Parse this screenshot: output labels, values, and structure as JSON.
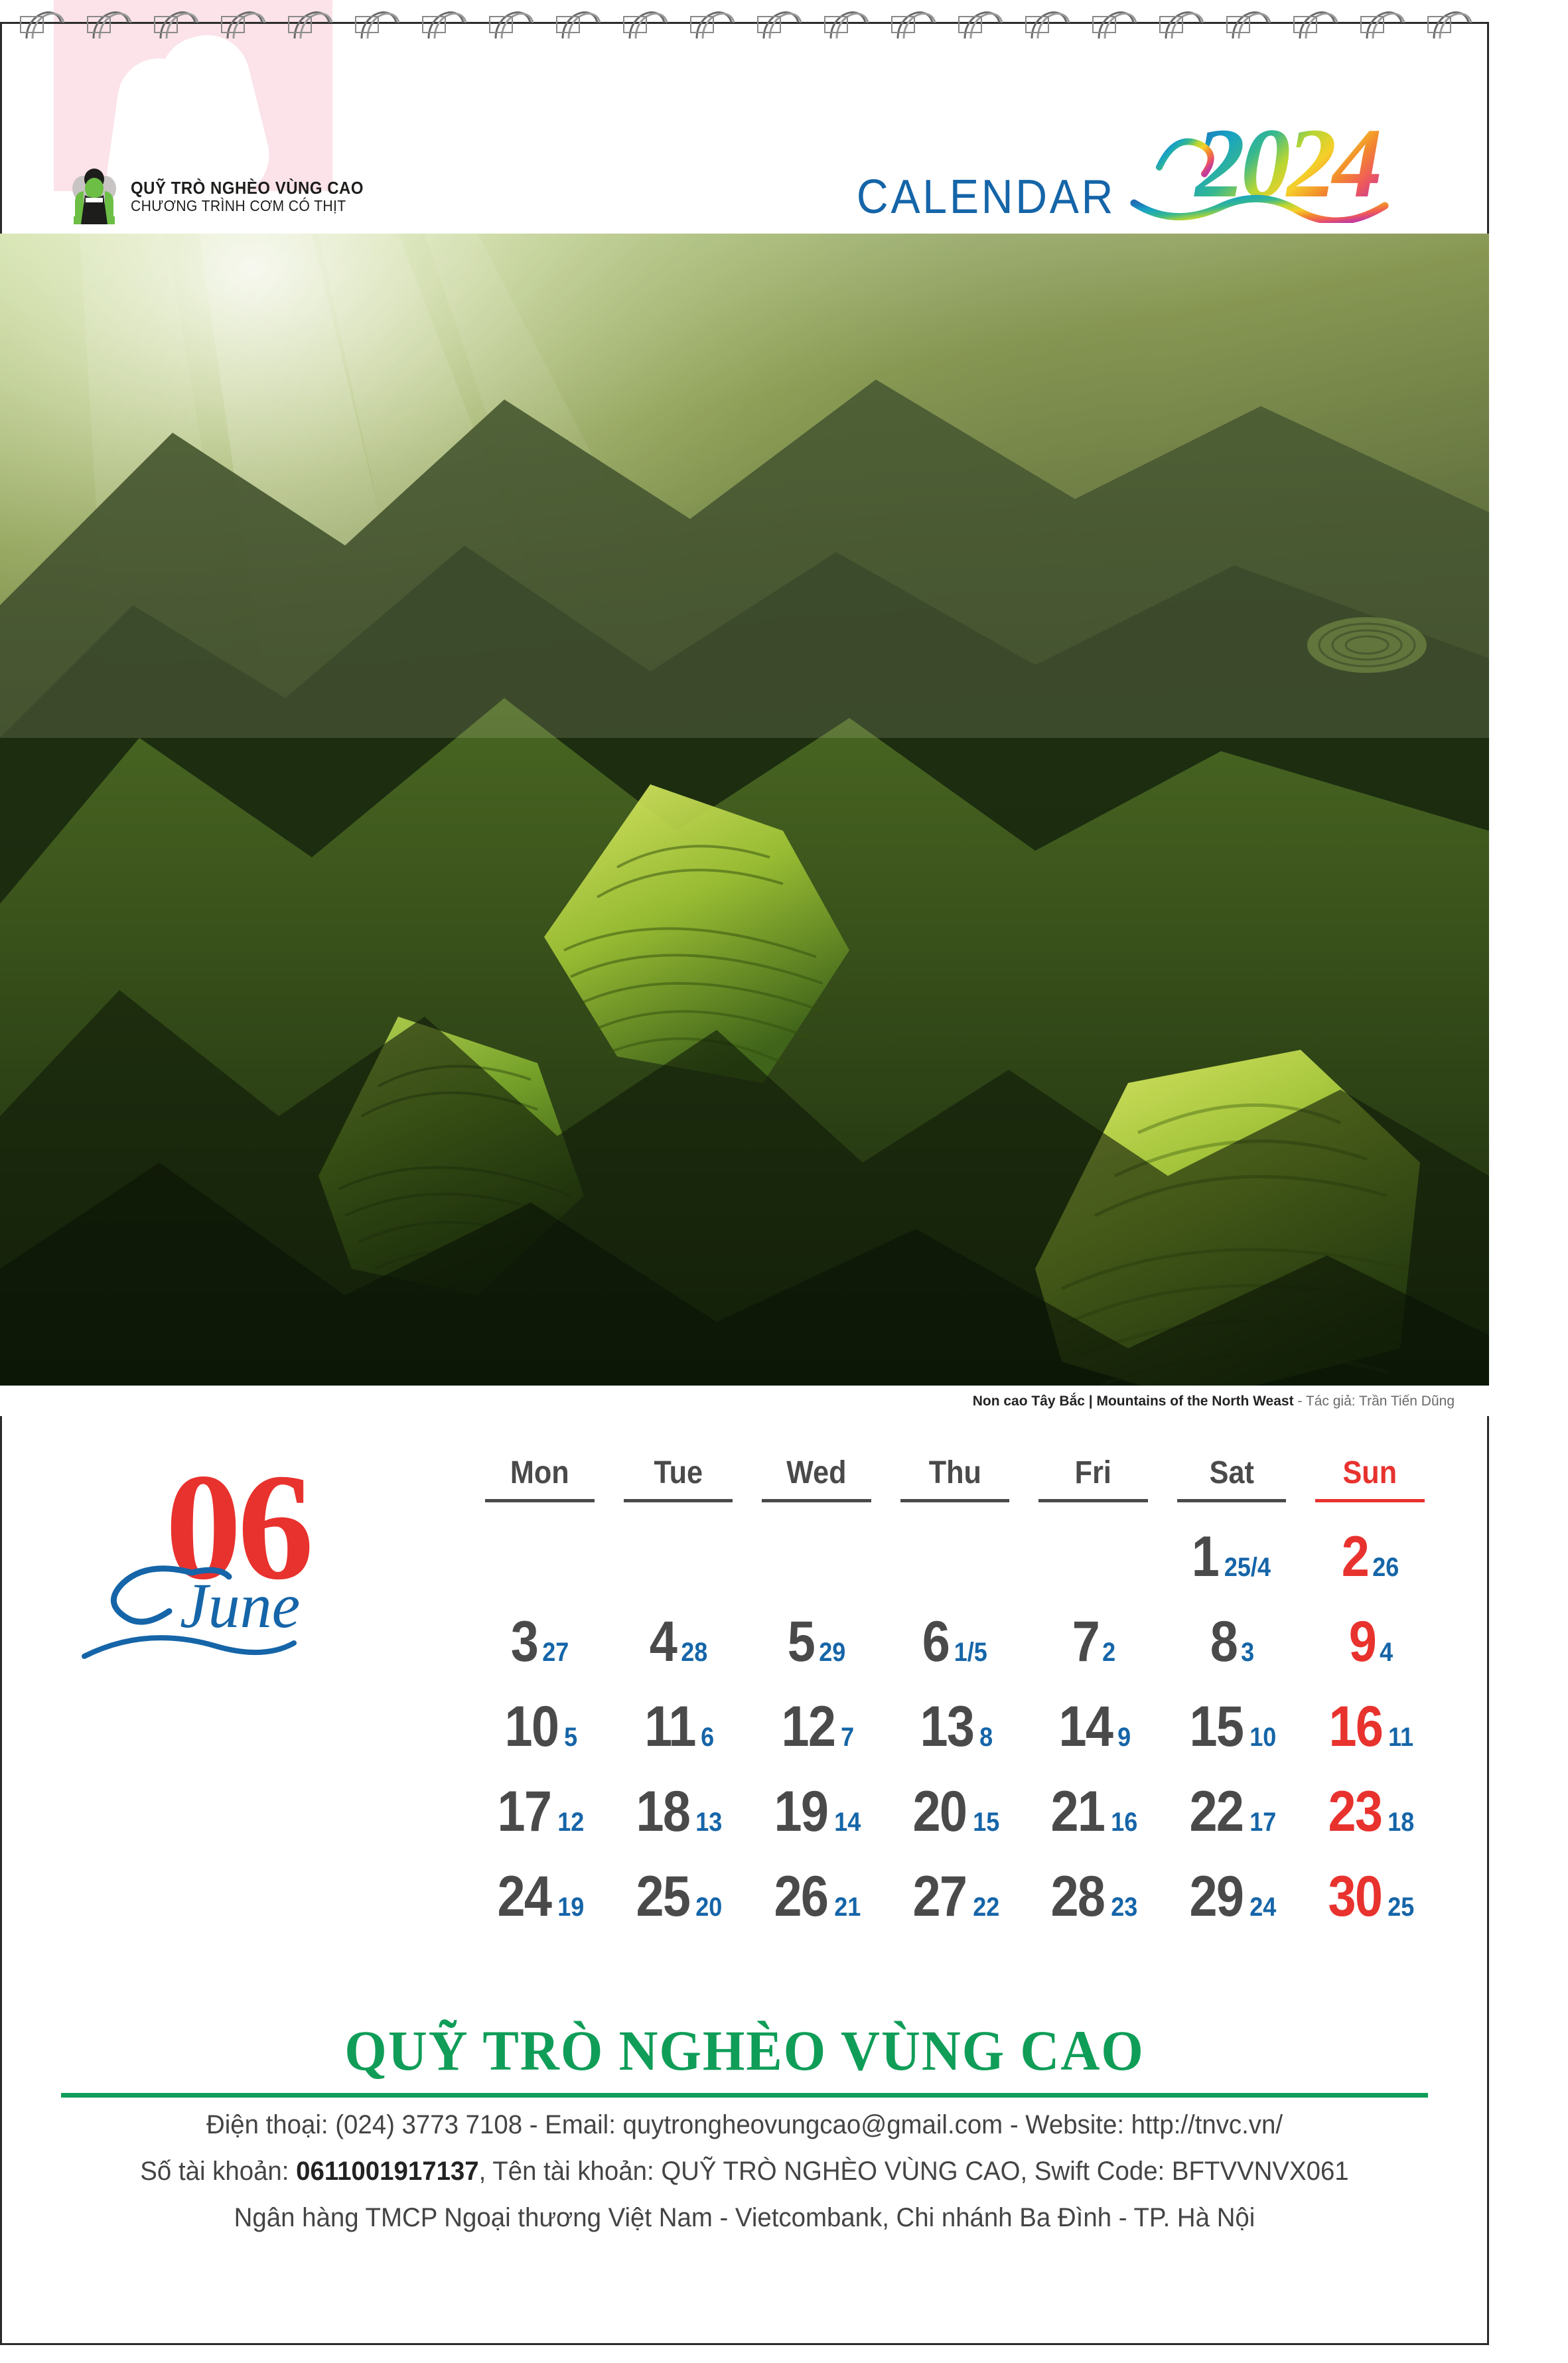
{
  "header": {
    "calendar_label": "CALENDAR",
    "year": "2024",
    "logo": {
      "line1": "QUỸ TRÒ NGHÈO VÙNG CAO",
      "line2": "CHƯƠNG TRÌNH CƠM CÓ THỊT"
    }
  },
  "photo": {
    "caption_vi": "Non cao Tây Bắc",
    "caption_sep": " | ",
    "caption_en": "Mountains of the North Weast",
    "caption_author": " - Tác giả: Trần Tiến Dũng"
  },
  "month": {
    "number": "06",
    "name": "June"
  },
  "weekdays": [
    {
      "label": "Mon",
      "sunday": false
    },
    {
      "label": "Tue",
      "sunday": false
    },
    {
      "label": "Wed",
      "sunday": false
    },
    {
      "label": "Thu",
      "sunday": false
    },
    {
      "label": "Fri",
      "sunday": false
    },
    {
      "label": "Sat",
      "sunday": false
    },
    {
      "label": "Sun",
      "sunday": true
    }
  ],
  "weeks": [
    [
      {
        "day": "",
        "lunar": ""
      },
      {
        "day": "",
        "lunar": ""
      },
      {
        "day": "",
        "lunar": ""
      },
      {
        "day": "",
        "lunar": ""
      },
      {
        "day": "",
        "lunar": ""
      },
      {
        "day": "1",
        "lunar": "25/4"
      },
      {
        "day": "2",
        "lunar": "26"
      }
    ],
    [
      {
        "day": "3",
        "lunar": "27"
      },
      {
        "day": "4",
        "lunar": "28"
      },
      {
        "day": "5",
        "lunar": "29"
      },
      {
        "day": "6",
        "lunar": "1/5"
      },
      {
        "day": "7",
        "lunar": "2"
      },
      {
        "day": "8",
        "lunar": "3"
      },
      {
        "day": "9",
        "lunar": "4"
      }
    ],
    [
      {
        "day": "10",
        "lunar": "5"
      },
      {
        "day": "11",
        "lunar": "6"
      },
      {
        "day": "12",
        "lunar": "7"
      },
      {
        "day": "13",
        "lunar": "8"
      },
      {
        "day": "14",
        "lunar": "9"
      },
      {
        "day": "15",
        "lunar": "10"
      },
      {
        "day": "16",
        "lunar": "11"
      }
    ],
    [
      {
        "day": "17",
        "lunar": "12"
      },
      {
        "day": "18",
        "lunar": "13"
      },
      {
        "day": "19",
        "lunar": "14"
      },
      {
        "day": "20",
        "lunar": "15"
      },
      {
        "day": "21",
        "lunar": "16"
      },
      {
        "day": "22",
        "lunar": "17"
      },
      {
        "day": "23",
        "lunar": "18"
      }
    ],
    [
      {
        "day": "24",
        "lunar": "19"
      },
      {
        "day": "25",
        "lunar": "20"
      },
      {
        "day": "26",
        "lunar": "21"
      },
      {
        "day": "27",
        "lunar": "22"
      },
      {
        "day": "28",
        "lunar": "23"
      },
      {
        "day": "29",
        "lunar": "24"
      },
      {
        "day": "30",
        "lunar": "25"
      }
    ]
  ],
  "footer": {
    "org_name": "QUỸ TRÒ NGHÈO VÙNG CAO",
    "line1": "Điện thoại: (024) 3773 7108 - Email: quytrongheovungcao@gmail.com - Website: http://tnvc.vn/",
    "line2_prefix": "Số tài khoản: ",
    "line2_account": "0611001917137",
    "line2_suffix": ", Tên tài khoản: QUỸ TRÒ NGHÈO VÙNG CAO, Swift Code: BFTVVNVX061",
    "line3": "Ngân hàng TMCP Ngoại thương Việt Nam - Vietcombank, Chi nhánh Ba Đình - TP. Hà Nội"
  },
  "colors": {
    "red": "#e8322e",
    "blue": "#1565a8",
    "green": "#0f9d58",
    "gray": "#4a4a4a",
    "pink": "#fbe3e9"
  }
}
